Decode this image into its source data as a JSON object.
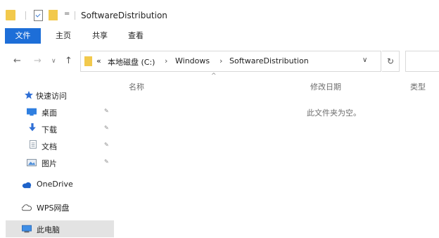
{
  "window": {
    "title": "SoftwareDistribution"
  },
  "quick_access_toolbar": {
    "dropdown_glyph": "="
  },
  "ribbon": {
    "tabs": [
      {
        "label": "文件"
      },
      {
        "label": "主页"
      },
      {
        "label": "共享"
      },
      {
        "label": "查看"
      }
    ]
  },
  "navigation": {
    "back_glyph": "←",
    "forward_glyph": "→",
    "recent_glyph": "∨",
    "up_glyph": "↑",
    "address": {
      "prefix": "«",
      "crumbs": [
        "本地磁盘 (C:)",
        "Windows",
        "SoftwareDistribution"
      ],
      "separator": "›",
      "dropdown_glyph": "∨"
    },
    "refresh_glyph": "↻"
  },
  "sidebar": {
    "items": [
      {
        "label": "快速访问",
        "icon": "star-icon"
      },
      {
        "label": "桌面",
        "icon": "desktop-icon",
        "pinned": true
      },
      {
        "label": "下载",
        "icon": "download-icon",
        "pinned": true
      },
      {
        "label": "文档",
        "icon": "document-icon",
        "pinned": true
      },
      {
        "label": "图片",
        "icon": "pictures-icon",
        "pinned": true
      },
      {
        "label": "OneDrive",
        "icon": "cloud-icon"
      },
      {
        "label": "WPS网盘",
        "icon": "wps-cloud-icon"
      },
      {
        "label": "此电脑",
        "icon": "computer-icon",
        "selected": true
      }
    ]
  },
  "file_list": {
    "columns": [
      "名称",
      "修改日期",
      "类型"
    ],
    "sort_glyph": "^",
    "empty_message": "此文件夹为空。"
  },
  "colors": {
    "file_tab": "#1d6ed8",
    "folder": "#f2c94c",
    "selected_item": "#e3e3e3"
  }
}
